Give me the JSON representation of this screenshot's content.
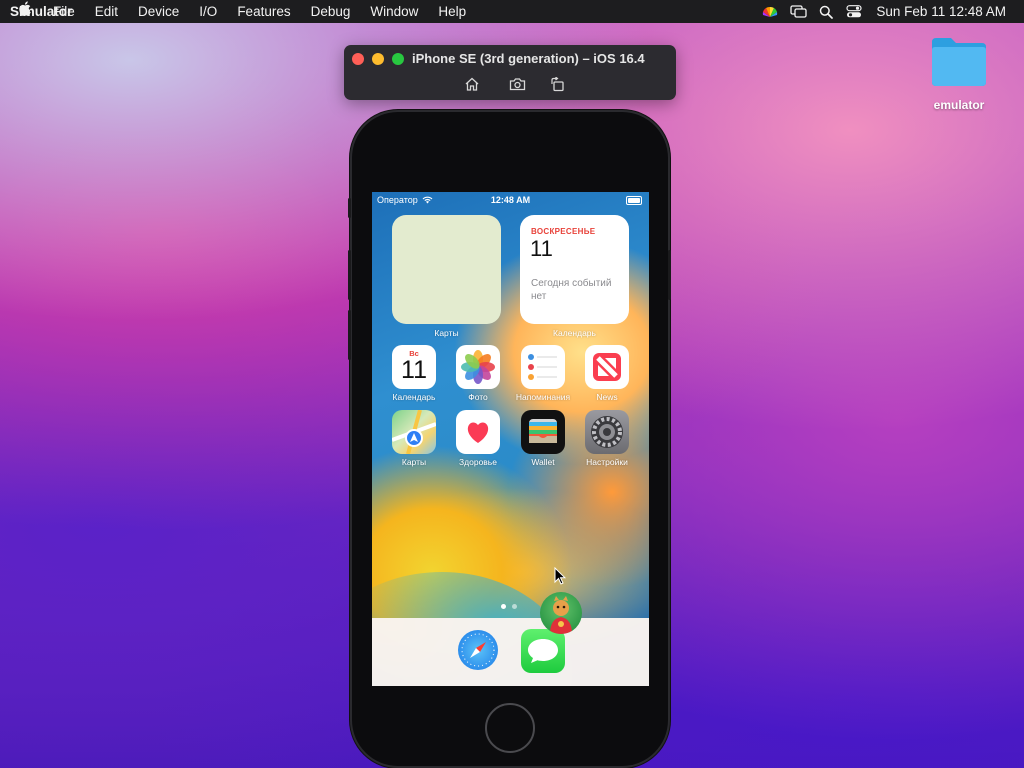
{
  "menubar": {
    "apple": "",
    "app_name": "Simulator",
    "menus": [
      "File",
      "Edit",
      "Device",
      "I/O",
      "Features",
      "Debug",
      "Window",
      "Help"
    ],
    "clock": "Sun Feb 11  12:48 AM",
    "status_icons": [
      "color-wheel-icon",
      "screen-mirror-icon",
      "spotlight-search-icon",
      "control-center-icon"
    ]
  },
  "desktop": {
    "folder_label": "emulator"
  },
  "simulator": {
    "window_title": "iPhone SE (3rd generation) – iOS 16.4",
    "toolbar": [
      "home-icon",
      "screenshot-icon",
      "rotate-icon"
    ],
    "traffic_lights": {
      "close": "#ff5f57",
      "minimize": "#febc2e",
      "zoom": "#28c840"
    }
  },
  "ios": {
    "status": {
      "carrier": "Оператор",
      "time": "12:48 AM"
    },
    "widgets": {
      "maps_label": "Карты",
      "calendar": {
        "weekday": "ВОСКРЕСЕНЬЕ",
        "day": "11",
        "events": "Сегодня событий нет",
        "label": "Календарь"
      }
    },
    "apps": [
      {
        "label": "Календарь",
        "icon": "calendar-icon",
        "weekday": "Вс",
        "day": "11"
      },
      {
        "label": "Фото",
        "icon": "photos-icon"
      },
      {
        "label": "Напоминания",
        "icon": "reminders-icon"
      },
      {
        "label": "News",
        "icon": "news-icon"
      },
      {
        "label": "Карты",
        "icon": "maps-icon"
      },
      {
        "label": "Здоровье",
        "icon": "health-icon"
      },
      {
        "label": "Wallet",
        "icon": "wallet-icon"
      },
      {
        "label": "Настройки",
        "icon": "settings-icon"
      }
    ],
    "dock": [
      "safari-icon",
      "messages-icon"
    ],
    "page_count": 2,
    "current_page": 1
  }
}
